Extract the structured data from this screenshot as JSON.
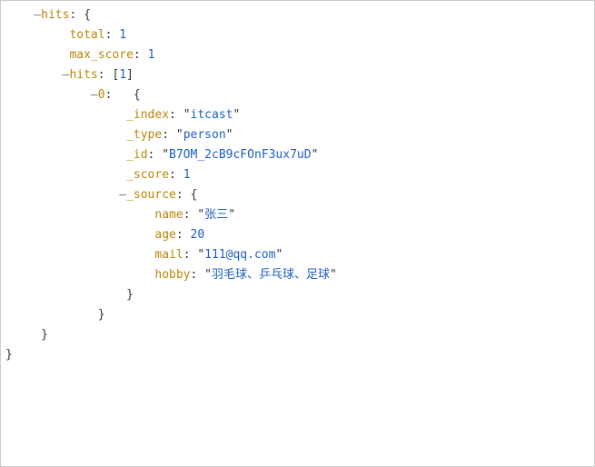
{
  "lines": {
    "l1_key": "hits",
    "l2_key": "total",
    "l2_val": "1",
    "l3_key": "max_score",
    "l3_val": "1",
    "l4_key": "hits",
    "l4_len": "1",
    "l5_key": "0",
    "l6_key": "_index",
    "l6_val": "itcast",
    "l7_key": "_type",
    "l7_val": "person",
    "l8_key": "_id",
    "l8_val": "B7OM_2cB9cFOnF3ux7uD",
    "l9_key": "_score",
    "l9_val": "1",
    "l10_key": "_source",
    "l11_key": "name",
    "l11_val": "张三",
    "l12_key": "age",
    "l12_val": "20",
    "l13_key": "mail",
    "l13_val": "111@qq.com",
    "l14_key": "hobby",
    "l14_val": "羽毛球、乒乓球、足球"
  }
}
